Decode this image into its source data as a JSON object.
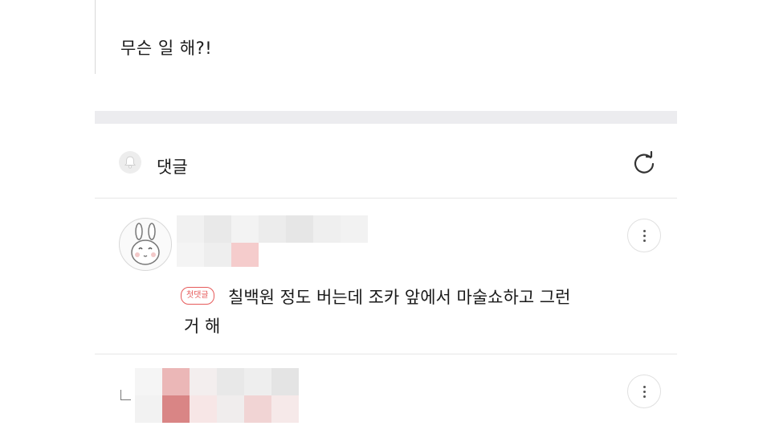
{
  "post": {
    "text": "무슨 일 해?!"
  },
  "comments_section": {
    "title": "댓글",
    "bell_icon": "bell-icon",
    "refresh_icon": "refresh-icon"
  },
  "comments": [
    {
      "badge": "첫댓글",
      "text_line1": "칠백원 정도 버는데 조카 앞에서 마술쇼하고 그런",
      "text_line2": "거 해",
      "more_icon": "more-vertical-icon"
    },
    {
      "more_icon": "more-vertical-icon"
    }
  ],
  "colors": {
    "badge": "#e65a5a",
    "divider": "#ececef"
  }
}
